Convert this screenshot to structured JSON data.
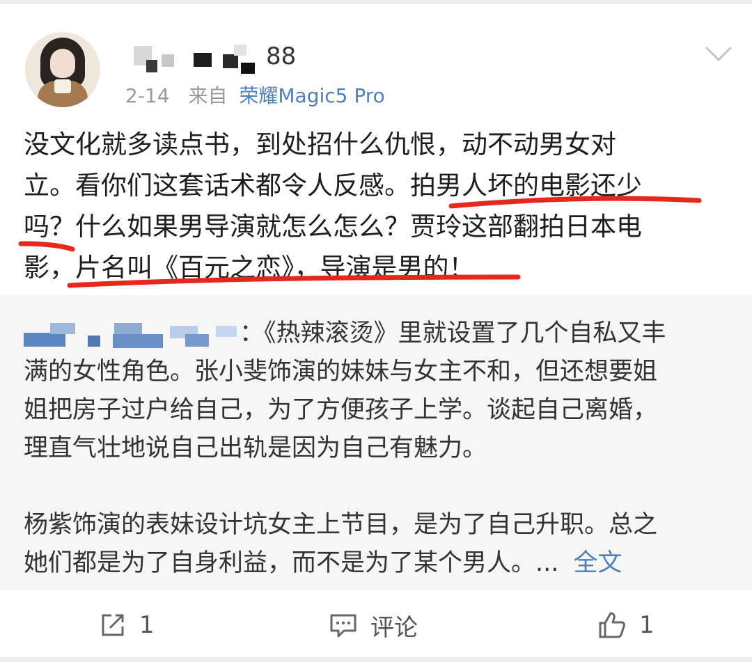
{
  "post": {
    "username_suffix": "88",
    "date": "2-14",
    "source_prefix": "来自",
    "device": "荣耀Magic5 Pro",
    "lines": [
      "没文化就多读点书，到处招什么仇恨，动不动男女对",
      "立。看你们这套话术都令人反感。拍男人坏的电影还少",
      "吗？什么如果男导演就怎么怎么？贾玲这部翻拍日本电",
      "影，片名叫《百元之恋》，导演是男的！"
    ]
  },
  "retweet": {
    "first_line_rest": "：《热辣滚烫》里就设置了几个自私又丰",
    "lines": [
      "满的女性角色。张小斐饰演的妹妹与女主不和，但还想要姐",
      "姐把房子过户给自己，为了方便孩子上学。谈起自己离婚，",
      "理直气壮地说自己出轨是因为自己有魅力。"
    ],
    "para2_line1": "杨紫饰演的表妹设计坑女主上节目，是为了自己升职。总之",
    "para2_line2": "她们都是为了自身利益，而不是为了某个男人。...",
    "full_text_link": "全文"
  },
  "actions": {
    "repost_count": "1",
    "comment_label": "评论",
    "like_count": "1"
  },
  "colors": {
    "link_blue": "#4e7fb8",
    "underline_red": "#e5281e",
    "retweet_bg": "#f6f6f6"
  },
  "icons": [
    "chevron-down-icon",
    "repost-icon",
    "comment-icon",
    "like-icon"
  ]
}
